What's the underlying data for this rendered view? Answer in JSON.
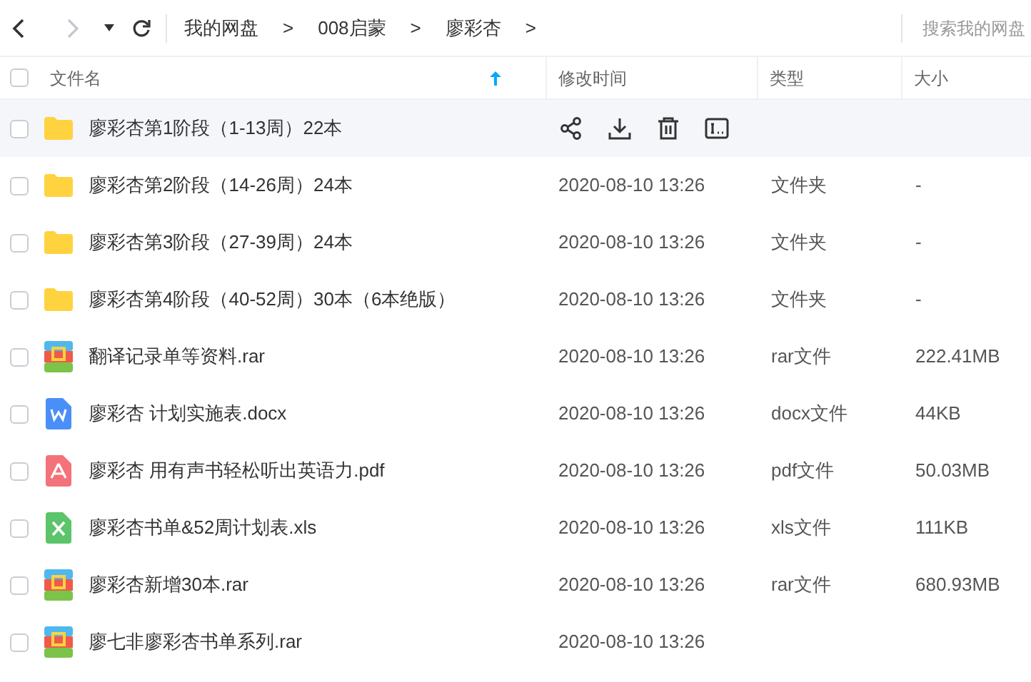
{
  "toolbar": {
    "back_disabled": false,
    "forward_disabled": true,
    "breadcrumb": [
      "我的网盘",
      "008启蒙",
      "廖彩杏"
    ],
    "separator": ">",
    "search": {
      "placeholder": "搜索我的网盘"
    }
  },
  "table": {
    "all_checked": false,
    "columns": [
      "文件名",
      "修改时间",
      "类型",
      "大小"
    ],
    "rows": [
      {
        "name": "廖彩杏第1阶段（1-13周）22本",
        "kind": "folder",
        "hovered": true,
        "checked": false
      },
      {
        "name": "廖彩杏第2阶段（14-26周）24本",
        "kind": "folder",
        "hovered": false,
        "checked": false,
        "time": "2020-08-10 13:26",
        "type": "文件夹",
        "size": "-"
      },
      {
        "name": "廖彩杏第3阶段（27-39周）24本",
        "kind": "folder",
        "hovered": false,
        "checked": false,
        "time": "2020-08-10 13:26",
        "type": "文件夹",
        "size": "-"
      },
      {
        "name": "廖彩杏第4阶段（40-52周）30本（6本绝版）",
        "kind": "folder",
        "hovered": false,
        "checked": false,
        "time": "2020-08-10 13:26",
        "type": "文件夹",
        "size": "-"
      },
      {
        "name": "翻译记录单等资料.rar",
        "kind": "archive",
        "hovered": false,
        "checked": false,
        "time": "2020-08-10 13:26",
        "type": "rar文件",
        "size": "222.41MB"
      },
      {
        "name": "廖彩杏 计划实施表.docx",
        "kind": "word",
        "hovered": false,
        "checked": false,
        "time": "2020-08-10 13:26",
        "type": "docx文件",
        "size": "44KB"
      },
      {
        "name": "廖彩杏 用有声书轻松听出英语力.pdf",
        "kind": "pdf",
        "hovered": false,
        "checked": false,
        "time": "2020-08-10 13:26",
        "type": "pdf文件",
        "size": "50.03MB"
      },
      {
        "name": "廖彩杏书单&52周计划表.xls",
        "kind": "excel",
        "hovered": false,
        "checked": false,
        "time": "2020-08-10 13:26",
        "type": "xls文件",
        "size": "111KB"
      },
      {
        "name": "廖彩杏新增30本.rar",
        "kind": "archive",
        "hovered": false,
        "checked": false,
        "time": "2020-08-10 13:26",
        "type": "rar文件",
        "size": "680.93MB"
      },
      {
        "name": "廖七非廖彩杏书单系列.rar",
        "kind": "archive",
        "hovered": false,
        "checked": false,
        "time": "2020-08-10 13:26"
      }
    ]
  }
}
